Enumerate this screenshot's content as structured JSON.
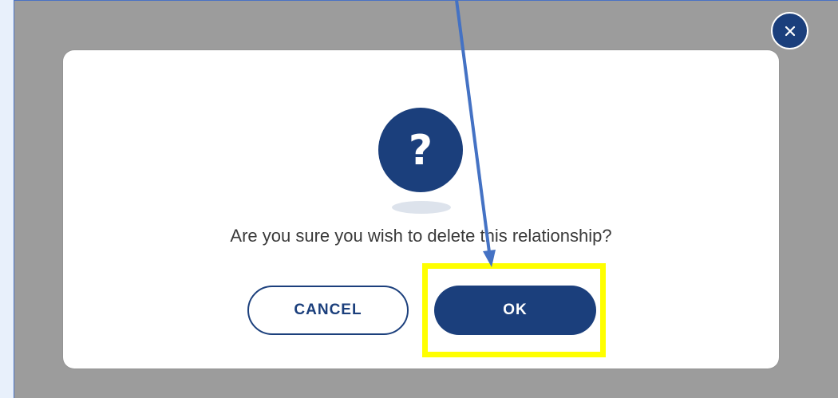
{
  "dialog": {
    "message": "Are you sure you wish to delete this relationship?",
    "cancel_label": "CANCEL",
    "ok_label": "OK",
    "question_symbol": "?"
  },
  "icons": {
    "close": "close-icon",
    "question": "question-icon"
  },
  "annotation": {
    "highlight_color": "#ffff00",
    "arrow_color": "#4472c4",
    "target": "ok-button"
  },
  "colors": {
    "accent": "#1b3f7c",
    "overlay": "#9c9c9c",
    "dialog_bg": "#ffffff"
  }
}
